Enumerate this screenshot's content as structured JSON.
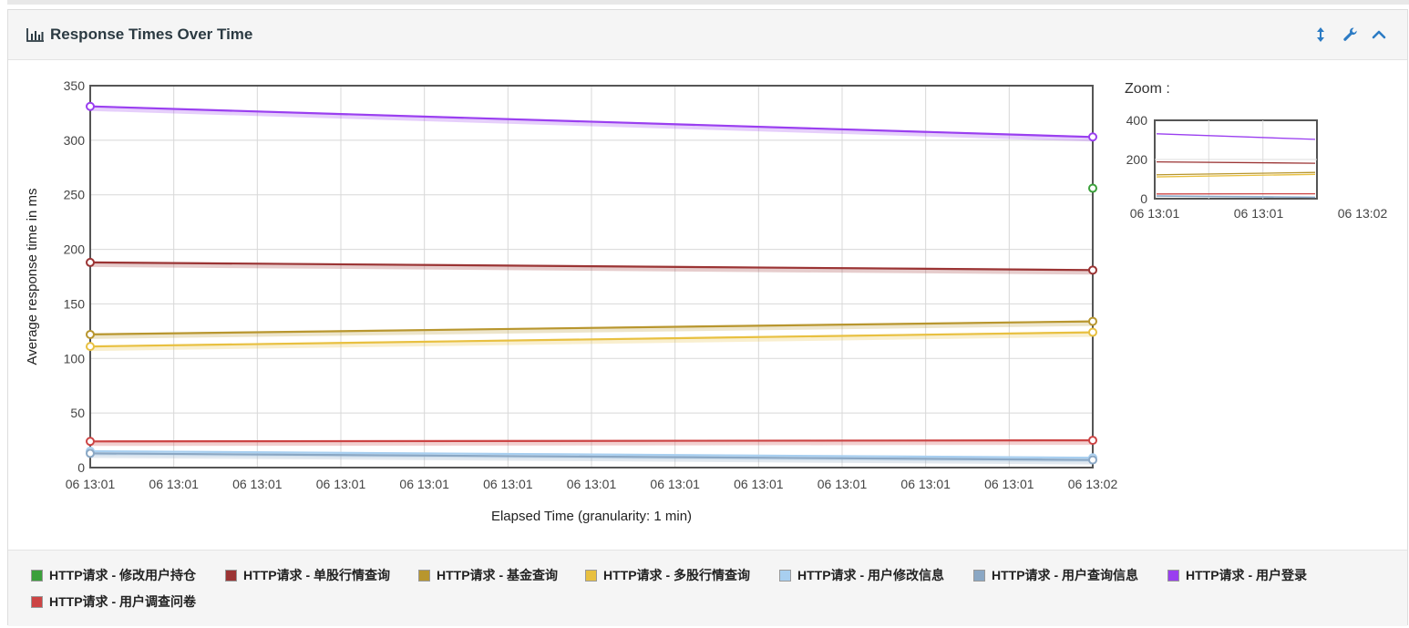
{
  "panel": {
    "title": "Response Times Over Time",
    "icons": {
      "title": "bar-chart-icon",
      "tools": [
        "resize-vertical-icon",
        "wrench-icon",
        "chevron-up-icon"
      ]
    }
  },
  "zoom": {
    "label": "Zoom :",
    "ylim": [
      0,
      400
    ],
    "yticks": [
      "400",
      "200",
      "0"
    ],
    "xticks": [
      "06 13:01",
      "06 13:01",
      "06 13:02"
    ]
  },
  "chart_data": {
    "type": "line",
    "title": "",
    "xlabel": "Elapsed Time (granularity: 1 min)",
    "ylabel": "Average response time in ms",
    "ylim": [
      0,
      350
    ],
    "yticks": [
      "350",
      "300",
      "250",
      "200",
      "150",
      "100",
      "50",
      "0"
    ],
    "xticks": [
      "06 13:01",
      "06 13:01",
      "06 13:01",
      "06 13:01",
      "06 13:01",
      "06 13:01",
      "06 13:01",
      "06 13:01",
      "06 13:01",
      "06 13:01",
      "06 13:01",
      "06 13:01",
      "06 13:02"
    ],
    "grid": true,
    "legend_position": "bottom",
    "series": [
      {
        "name": "HTTP请求 - 修改用户持仓",
        "color": "#3ba03b",
        "points": [
          [
            1,
            256
          ]
        ]
      },
      {
        "name": "HTTP请求 - 单股行情查询",
        "color": "#9b3434",
        "points": [
          [
            0,
            188
          ],
          [
            1,
            181
          ]
        ]
      },
      {
        "name": "HTTP请求 - 基金查询",
        "color": "#b8962e",
        "points": [
          [
            0,
            122
          ],
          [
            1,
            134
          ]
        ]
      },
      {
        "name": "HTTP请求 - 多股行情查询",
        "color": "#e8c040",
        "points": [
          [
            0,
            111
          ],
          [
            1,
            124
          ]
        ]
      },
      {
        "name": "HTTP请求 - 用户修改信息",
        "color": "#a8cff0",
        "points": [
          [
            0,
            15
          ],
          [
            1,
            9
          ]
        ]
      },
      {
        "name": "HTTP请求 - 用户查询信息",
        "color": "#8aa7c4",
        "points": [
          [
            0,
            13
          ],
          [
            1,
            7
          ]
        ]
      },
      {
        "name": "HTTP请求 - 用户登录",
        "color": "#9a3ff0",
        "points": [
          [
            0,
            331
          ],
          [
            1,
            303
          ]
        ]
      },
      {
        "name": "HTTP请求 - 用户调查问卷",
        "color": "#cc4444",
        "points": [
          [
            0,
            24
          ],
          [
            1,
            25
          ]
        ]
      }
    ]
  }
}
